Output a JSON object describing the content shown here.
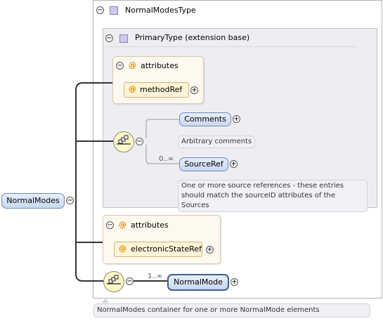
{
  "root": {
    "label": "NormalModes",
    "doc": "NormalModes container for one or more NormalMode elements"
  },
  "complex_type": {
    "label": "NormalModesType"
  },
  "base_type": {
    "label": "PrimaryType (extension base)"
  },
  "attributes_group_1": {
    "label": "attributes",
    "items": [
      "methodRef"
    ]
  },
  "sequence_inner": {
    "elements": [
      {
        "label": "Comments",
        "doc": "Arbitrary comments",
        "cardinality": ""
      },
      {
        "label": "SourceRef",
        "doc_line1": "One or more source references - these entries",
        "doc_line2": "should match the sourceID attributes of the Sources",
        "cardinality": "0..∞"
      }
    ]
  },
  "attributes_group_2": {
    "label": "attributes",
    "items": [
      "electronicStateRef"
    ]
  },
  "sequence_outer": {
    "element": {
      "label": "NormalMode",
      "cardinality": "1..∞"
    }
  },
  "icons": [
    "collapse-icon",
    "expand-icon",
    "type-icon",
    "attribute-icon",
    "sequence-icon"
  ],
  "colors": {
    "element_fill": "#c8d8f0",
    "attribute_fill": "#fff3d8",
    "attribute_accent": "#e08a00",
    "type_icon": "#cfc8ec",
    "sequence_fill": "#fbf8c9"
  }
}
